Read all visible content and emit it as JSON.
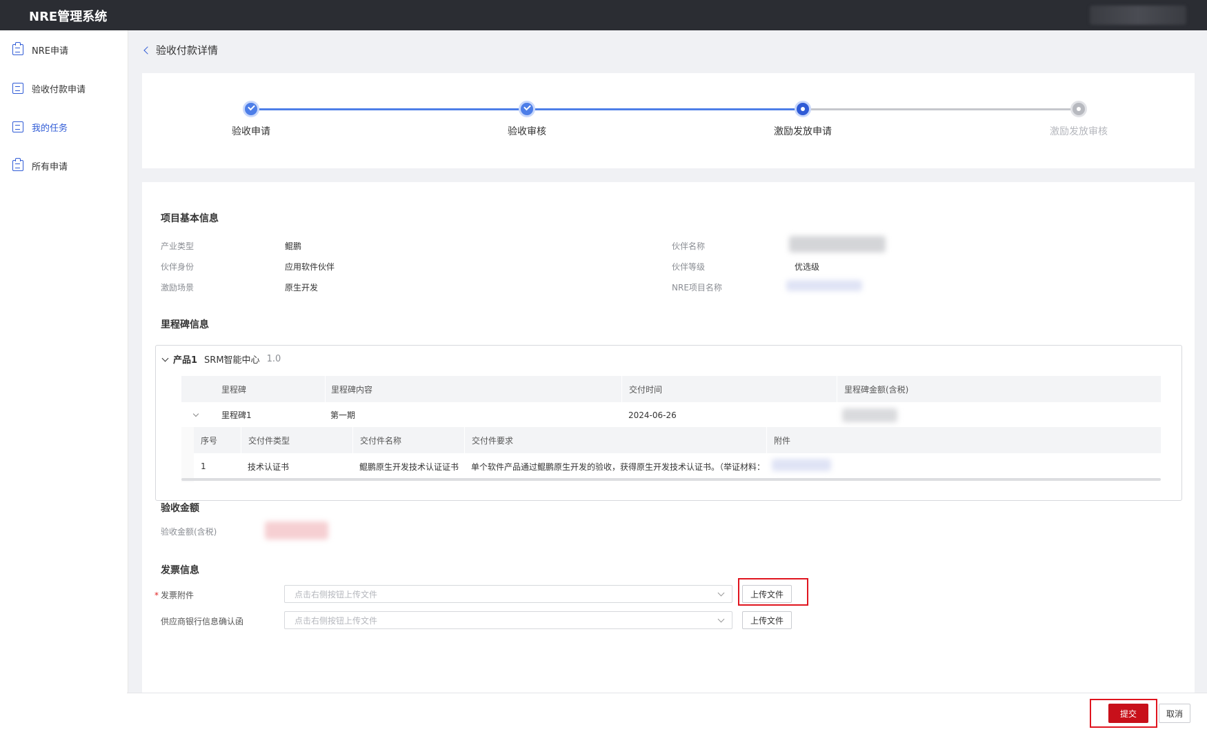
{
  "app": {
    "title": "NRE管理系统"
  },
  "sidebar": {
    "items": [
      {
        "label": "NRE申请",
        "icon": "clipboard-icon"
      },
      {
        "label": "验收付款申请",
        "icon": "list-icon"
      },
      {
        "label": "我的任务",
        "icon": "list-icon",
        "active": true
      },
      {
        "label": "所有申请",
        "icon": "clipboard-icon"
      }
    ]
  },
  "page": {
    "title": "验收付款详情"
  },
  "steps": [
    {
      "label": "验收申请",
      "state": "done"
    },
    {
      "label": "验收审核",
      "state": "done"
    },
    {
      "label": "激励发放申请",
      "state": "current"
    },
    {
      "label": "激励发放审核",
      "state": "todo"
    }
  ],
  "basic_info": {
    "title": "项目基本信息",
    "industry_type_label": "产业类型",
    "industry_type_value": "鲲鹏",
    "partner_identity_label": "伙伴身份",
    "partner_identity_value": "应用软件伙伴",
    "incentive_scene_label": "激励场景",
    "incentive_scene_value": "原生开发",
    "partner_name_label": "伙伴名称",
    "partner_level_label": "伙伴等级",
    "partner_level_value": "优选级",
    "nre_project_label": "NRE项目名称"
  },
  "milestone": {
    "title": "里程碑信息",
    "product_label": "产品1",
    "product_name": "SRM智能中心",
    "product_version": "1.0",
    "columns": [
      "里程碑",
      "里程碑内容",
      "交付时间",
      "里程碑金额(含税)"
    ],
    "row": {
      "name": "里程碑1",
      "content": "第一期",
      "date": "2024-06-26"
    },
    "sub_columns": [
      "序号",
      "交付件类型",
      "交付件名称",
      "交付件要求",
      "附件"
    ],
    "sub_row": {
      "index": "1",
      "type": "技术认证书",
      "name": "鲲鹏原生开发技术认证证书",
      "requirement": "单个软件产品通过鲲鹏原生开发的验收，获得原生开发技术认证书。（举证材料：鲲..."
    }
  },
  "acceptance": {
    "title": "验收金额",
    "amount_label": "验收金额(含税)"
  },
  "invoice": {
    "title": "发票信息",
    "required_mark": "*",
    "attachment_label": "发票附件",
    "attachment_placeholder": "点击右侧按钮上传文件",
    "bank_label": "供应商银行信息确认函",
    "bank_placeholder": "点击右侧按钮上传文件",
    "upload_label": "上传文件"
  },
  "footer": {
    "submit_label": "提交",
    "cancel_label": "取消"
  },
  "colors": {
    "primary": "#2f5bd6",
    "topbar": "#2b2d33",
    "submit": "#c8101a",
    "highlight": "#e0141e"
  }
}
